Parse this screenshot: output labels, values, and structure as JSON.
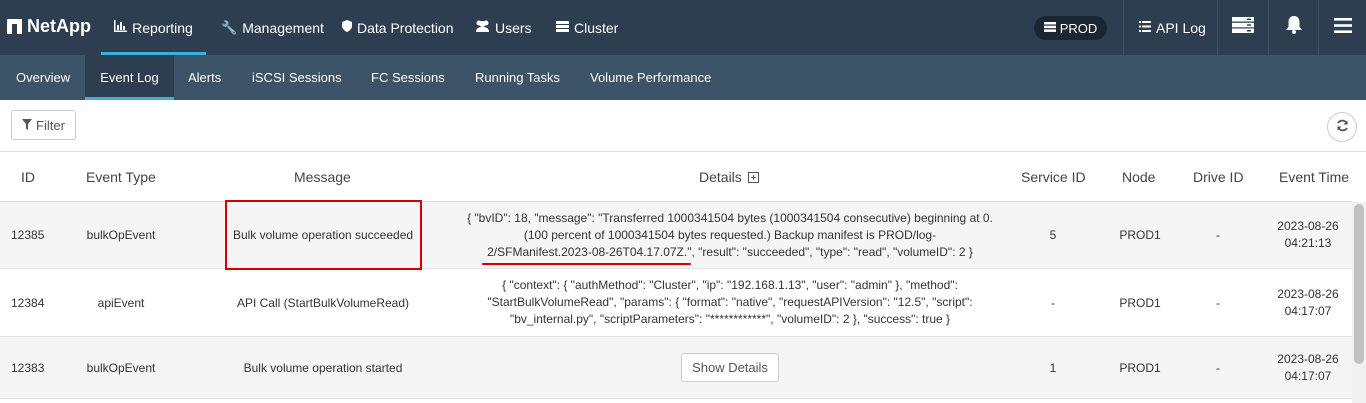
{
  "topnav": {
    "brand": "NetApp",
    "items": [
      {
        "label": "Reporting",
        "icon": "bar-chart-icon"
      },
      {
        "label": "Management",
        "icon": "wrench-icon"
      },
      {
        "label": "Data Protection",
        "icon": "shield-icon"
      },
      {
        "label": "Users",
        "icon": "users-icon"
      },
      {
        "label": "Cluster",
        "icon": "server-icon"
      }
    ],
    "environment": "PROD",
    "api_log": "API Log"
  },
  "subnav": {
    "items": [
      "Overview",
      "Event Log",
      "Alerts",
      "iSCSI Sessions",
      "FC Sessions",
      "Running Tasks",
      "Volume Performance"
    ]
  },
  "toolbar": {
    "filter_label": "Filter"
  },
  "table": {
    "headers": [
      "ID",
      "Event Type",
      "Message",
      "Details",
      "Service ID",
      "Node",
      "Drive ID",
      "Event Time"
    ],
    "rows": [
      {
        "id": "12385",
        "event_type": "bulkOpEvent",
        "message": "Bulk volume operation succeeded",
        "details_lines": [
          "{ \"bvID\": 18, \"message\": \"Transferred 1000341504 bytes (1000341504 consecutive) beginning at 0.",
          "(100 percent of 1000341504 bytes requested.) Backup manifest is PROD/log-",
          "2/SFManifest.2023-08-26T04.17.07Z.\", \"result\": \"succeeded\", \"type\": \"read\", \"volumeID\": 2 }"
        ],
        "service_id": "5",
        "node": "PROD1",
        "drive_id": "-",
        "date": "2023-08-26",
        "time": "04:21:13"
      },
      {
        "id": "12384",
        "event_type": "apiEvent",
        "message": "API Call (StartBulkVolumeRead)",
        "details_lines": [
          "{ \"context\": { \"authMethod\": \"Cluster\", \"ip\": \"192.168.1.13\", \"user\": \"admin\" }, \"method\":",
          "\"StartBulkVolumeRead\", \"params\": { \"format\": \"native\", \"requestAPIVersion\": \"12.5\", \"script\":",
          "\"bv_internal.py\", \"scriptParameters\": \"************\", \"volumeID\": 2 }, \"success\": true }"
        ],
        "service_id": "-",
        "node": "PROD1",
        "drive_id": "-",
        "date": "2023-08-26",
        "time": "04:17:07"
      },
      {
        "id": "12383",
        "event_type": "bulkOpEvent",
        "message": "Bulk volume operation started",
        "details_button": "Show Details",
        "service_id": "1",
        "node": "PROD1",
        "drive_id": "-",
        "date": "2023-08-26",
        "time": "04:17:07"
      }
    ]
  },
  "annotation_color": "#d40000",
  "accent_color": "#3bb0e0"
}
